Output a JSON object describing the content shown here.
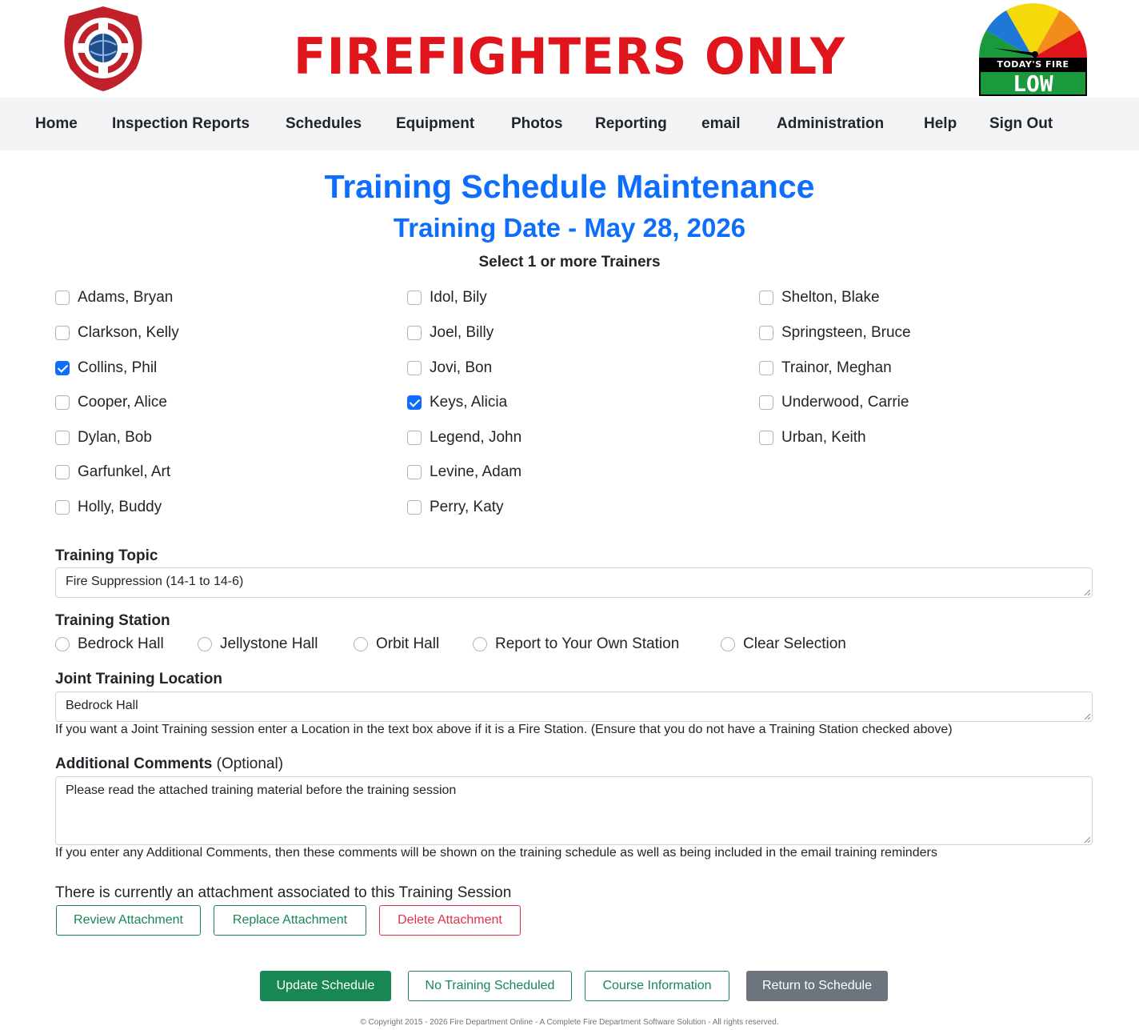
{
  "header": {
    "title": "FIREFIGHTERS ONLY",
    "fire_status_label": "TODAY'S FIRE STATUS",
    "fire_status_value": "LOW"
  },
  "nav": {
    "items": [
      "Home",
      "Inspection Reports",
      "Schedules",
      "Equipment",
      "Photos",
      "Reporting",
      "email",
      "Administration",
      "Help",
      "Sign Out"
    ]
  },
  "page": {
    "title": "Training Schedule Maintenance",
    "subtitle": "Training Date - May 28, 2026",
    "select_hint": "Select 1 or more Trainers"
  },
  "trainers": [
    {
      "name": "Adams, Bryan",
      "checked": false
    },
    {
      "name": "Clarkson, Kelly",
      "checked": false
    },
    {
      "name": "Collins, Phil",
      "checked": true
    },
    {
      "name": "Cooper, Alice",
      "checked": false
    },
    {
      "name": "Dylan, Bob",
      "checked": false
    },
    {
      "name": "Garfunkel, Art",
      "checked": false
    },
    {
      "name": "Holly, Buddy",
      "checked": false
    },
    {
      "name": "Idol, Bily",
      "checked": false
    },
    {
      "name": "Joel, Billy",
      "checked": false
    },
    {
      "name": "Jovi, Bon",
      "checked": false
    },
    {
      "name": "Keys, Alicia",
      "checked": true
    },
    {
      "name": "Legend, John",
      "checked": false
    },
    {
      "name": "Levine, Adam",
      "checked": false
    },
    {
      "name": "Perry, Katy",
      "checked": false
    },
    {
      "name": "Shelton, Blake",
      "checked": false
    },
    {
      "name": "Springsteen, Bruce",
      "checked": false
    },
    {
      "name": "Trainor, Meghan",
      "checked": false
    },
    {
      "name": "Underwood, Carrie",
      "checked": false
    },
    {
      "name": "Urban, Keith",
      "checked": false
    }
  ],
  "form": {
    "topic_label": "Training Topic",
    "topic_value": "Fire Suppression (14-1 to 14-6)",
    "station_label": "Training Station",
    "station_options": [
      "Bedrock Hall",
      "Jellystone Hall",
      "Orbit Hall",
      "Report to Your Own Station",
      "Clear Selection"
    ],
    "joint_label": "Joint Training Location",
    "joint_value": "Bedrock Hall",
    "joint_help": "If you want a Joint Training session enter a Location in the text box above if it is a Fire Station. (Ensure that you do not have a Training Station checked above)",
    "comments_label": "Additional Comments",
    "comments_optional": "(Optional)",
    "comments_value": "Please read the attached training material before the training session",
    "comments_help": "If you enter any Additional Comments, then these comments will be shown on the training schedule as well as being included in the email training reminders"
  },
  "attachment": {
    "note": "There is currently an attachment associated to this Training Session",
    "review_label": "Review Attachment",
    "replace_label": "Replace Attachment",
    "delete_label": "Delete Attachment"
  },
  "actions": {
    "update_label": "Update Schedule",
    "no_training_label": "No Training Scheduled",
    "course_info_label": "Course Information",
    "return_label": "Return to Schedule"
  },
  "footer": {
    "text": "© Copyright 2015 - 2026 Fire Department Online - A Complete Fire Department Software Solution - All rights reserved."
  },
  "colors": {
    "brand_red": "#e0141b",
    "title_blue": "#0d6efd",
    "success_green": "#198754",
    "danger_red": "#dc3545",
    "secondary_gray": "#6c757d",
    "nav_bg": "#f2f3f5"
  }
}
